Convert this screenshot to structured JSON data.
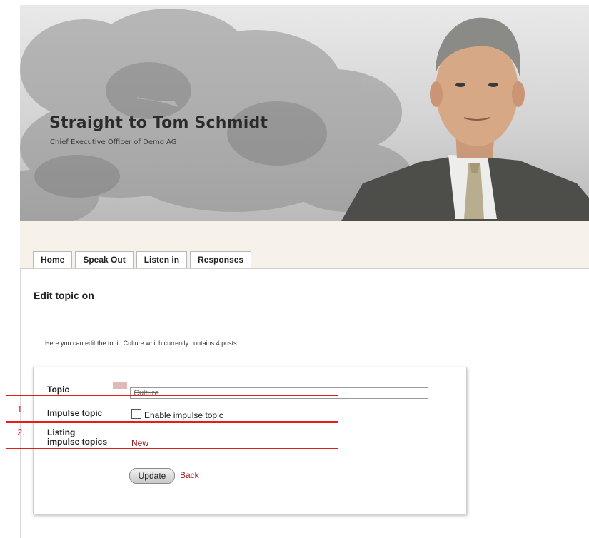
{
  "banner": {
    "title": "Straight to Tom Schmidt",
    "subtitle": "Chief Executive Officer of Demo AG",
    "portrait_icon": "person-portrait-icon",
    "tree_icon": "tree-silhouette-icon"
  },
  "tabs": [
    {
      "label": "Home"
    },
    {
      "label": "Speak Out"
    },
    {
      "label": "Listen in"
    },
    {
      "label": "Responses"
    }
  ],
  "main": {
    "heading": "Edit topic on",
    "intro": "Here you can edit the topic Culture which currently contains 4 posts."
  },
  "form": {
    "topic_label": "Topic",
    "topic_value": "Culture",
    "impulse_label": "Impulse topic",
    "impulse_checkbox_label": "Enable impulse topic",
    "listing_label_line1": "Listing",
    "listing_label_line2": "impulse topics",
    "new_link": "New",
    "update_button": "Update",
    "back_link": "Back"
  },
  "annotations": [
    {
      "number": "1."
    },
    {
      "number": "2."
    }
  ],
  "colors": {
    "link": "#a11a1a",
    "annotation": "#e41d1d",
    "strip": "#f6f2ea"
  }
}
